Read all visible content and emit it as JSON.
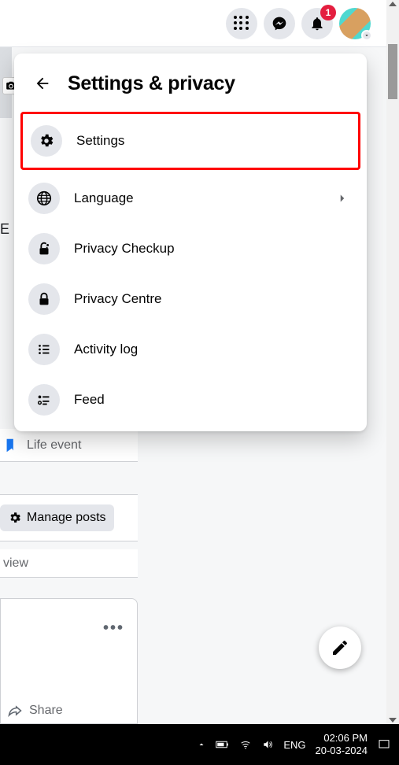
{
  "topbar": {
    "notifications_badge": "1"
  },
  "panel": {
    "title": "Settings & privacy",
    "items": [
      {
        "icon": "gear",
        "label": "Settings",
        "chevron": false,
        "highlight": true
      },
      {
        "icon": "globe",
        "label": "Language",
        "chevron": true,
        "highlight": false
      },
      {
        "icon": "lockdot",
        "label": "Privacy Checkup",
        "chevron": false,
        "highlight": false
      },
      {
        "icon": "lock",
        "label": "Privacy Centre",
        "chevron": false,
        "highlight": false
      },
      {
        "icon": "list",
        "label": "Activity log",
        "chevron": false,
        "highlight": false
      },
      {
        "icon": "feed",
        "label": "Feed",
        "chevron": false,
        "highlight": false
      }
    ]
  },
  "background": {
    "partial_left": "E",
    "life_event_label": "Life event",
    "manage_posts_label": "Manage posts",
    "view_label": "view",
    "share_label": "Share"
  },
  "taskbar": {
    "lang": "ENG",
    "time": "02:06 PM",
    "date": "20-03-2024"
  }
}
